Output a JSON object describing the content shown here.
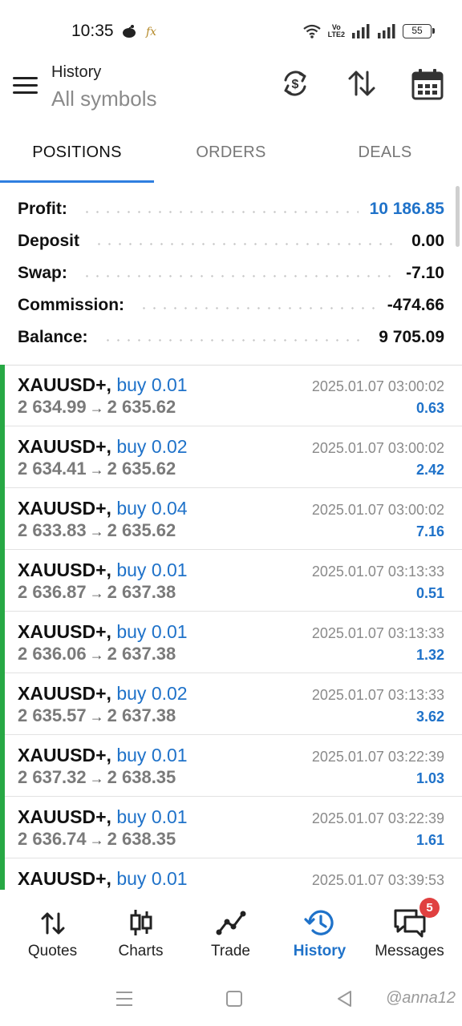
{
  "status_bar": {
    "time": "10:35",
    "lte_top": "Vo",
    "lte_bottom": "LTE2",
    "battery": "55"
  },
  "header": {
    "title": "History",
    "subtitle": "All symbols"
  },
  "tabs": [
    {
      "label": "POSITIONS",
      "active": true
    },
    {
      "label": "ORDERS",
      "active": false
    },
    {
      "label": "DEALS",
      "active": false
    }
  ],
  "summary": [
    {
      "label": "Profit:",
      "value": "10 186.85",
      "color": "#1f72c9"
    },
    {
      "label": "Deposit",
      "value": "0.00"
    },
    {
      "label": "Swap:",
      "value": "-7.10"
    },
    {
      "label": "Commission:",
      "value": "-474.66"
    },
    {
      "label": "Balance:",
      "value": "9 705.09"
    }
  ],
  "deals": [
    {
      "symbol": "XAUUSD+,",
      "type": "buy 0.01",
      "open": "2 634.99",
      "close": "2 635.62",
      "time": "2025.01.07 03:00:02",
      "profit": "0.63"
    },
    {
      "symbol": "XAUUSD+,",
      "type": "buy 0.02",
      "open": "2 634.41",
      "close": "2 635.62",
      "time": "2025.01.07 03:00:02",
      "profit": "2.42"
    },
    {
      "symbol": "XAUUSD+,",
      "type": "buy 0.04",
      "open": "2 633.83",
      "close": "2 635.62",
      "time": "2025.01.07 03:00:02",
      "profit": "7.16"
    },
    {
      "symbol": "XAUUSD+,",
      "type": "buy 0.01",
      "open": "2 636.87",
      "close": "2 637.38",
      "time": "2025.01.07 03:13:33",
      "profit": "0.51"
    },
    {
      "symbol": "XAUUSD+,",
      "type": "buy 0.01",
      "open": "2 636.06",
      "close": "2 637.38",
      "time": "2025.01.07 03:13:33",
      "profit": "1.32"
    },
    {
      "symbol": "XAUUSD+,",
      "type": "buy 0.02",
      "open": "2 635.57",
      "close": "2 637.38",
      "time": "2025.01.07 03:13:33",
      "profit": "3.62"
    },
    {
      "symbol": "XAUUSD+,",
      "type": "buy 0.01",
      "open": "2 637.32",
      "close": "2 638.35",
      "time": "2025.01.07 03:22:39",
      "profit": "1.03"
    },
    {
      "symbol": "XAUUSD+,",
      "type": "buy 0.01",
      "open": "2 636.74",
      "close": "2 638.35",
      "time": "2025.01.07 03:22:39",
      "profit": "1.61"
    },
    {
      "symbol": "XAUUSD+,",
      "type": "buy 0.01",
      "open": "",
      "close": "",
      "time": "2025.01.07 03:39:53",
      "profit": ""
    }
  ],
  "arrow": "→",
  "bottom_nav": [
    {
      "label": "Quotes",
      "icon": "quotes-arrows-icon",
      "active": false
    },
    {
      "label": "Charts",
      "icon": "candlestick-icon",
      "active": false
    },
    {
      "label": "Trade",
      "icon": "trade-line-icon",
      "active": false
    },
    {
      "label": "History",
      "icon": "history-clock-icon",
      "active": true
    },
    {
      "label": "Messages",
      "icon": "messages-icon",
      "active": false,
      "badge": "5"
    }
  ],
  "watermark": "@anna12",
  "colors": {
    "accent": "#1f72c9",
    "buy_bar": "#27a844",
    "badge": "#e04040"
  }
}
